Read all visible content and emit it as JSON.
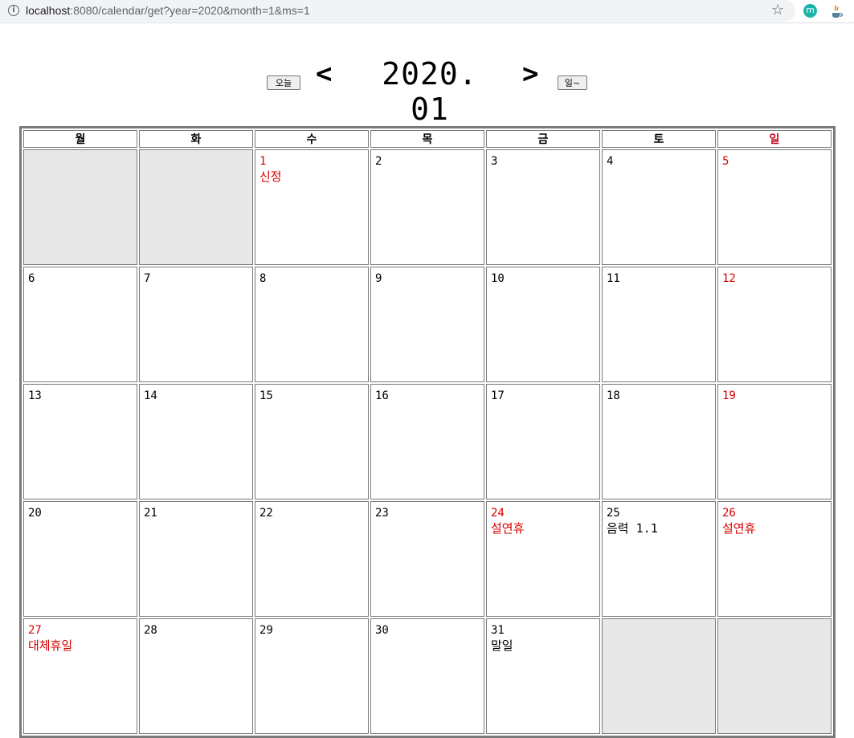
{
  "browser": {
    "url_host": "localhost",
    "url_rest": ":8080/calendar/get?year=2020&month=1&ms=1",
    "info_icon": "info-icon",
    "star_icon": "star-icon",
    "extensions": [
      {
        "name": "m-extension-icon",
        "label": "m"
      },
      {
        "name": "java-extension-icon",
        "label": ""
      }
    ]
  },
  "header": {
    "today_button": "오늘",
    "prev_arrow": "<",
    "title": "2020. 01",
    "next_arrow": ">",
    "week_start_button": "일~"
  },
  "weekdays": [
    "월",
    "화",
    "수",
    "목",
    "금",
    "토",
    "일"
  ],
  "weeks": [
    [
      {
        "empty": true
      },
      {
        "empty": true
      },
      {
        "day": "1",
        "note": "신정",
        "red": true
      },
      {
        "day": "2"
      },
      {
        "day": "3"
      },
      {
        "day": "4"
      },
      {
        "day": "5",
        "red": true
      }
    ],
    [
      {
        "day": "6"
      },
      {
        "day": "7"
      },
      {
        "day": "8"
      },
      {
        "day": "9"
      },
      {
        "day": "10"
      },
      {
        "day": "11"
      },
      {
        "day": "12",
        "red": true
      }
    ],
    [
      {
        "day": "13"
      },
      {
        "day": "14"
      },
      {
        "day": "15"
      },
      {
        "day": "16"
      },
      {
        "day": "17"
      },
      {
        "day": "18"
      },
      {
        "day": "19",
        "red": true
      }
    ],
    [
      {
        "day": "20"
      },
      {
        "day": "21"
      },
      {
        "day": "22"
      },
      {
        "day": "23"
      },
      {
        "day": "24",
        "note": "설연휴",
        "red": true
      },
      {
        "day": "25",
        "note": "음력 1.1"
      },
      {
        "day": "26",
        "note": "설연휴",
        "red": true
      }
    ],
    [
      {
        "day": "27",
        "note": "대체휴일",
        "red": true
      },
      {
        "day": "28"
      },
      {
        "day": "29"
      },
      {
        "day": "30"
      },
      {
        "day": "31",
        "note": "말일"
      },
      {
        "empty": true
      },
      {
        "empty": true
      }
    ]
  ],
  "colors": {
    "holiday": "#d90000",
    "empty_cell": "#e8e8e8",
    "border": "#7a7a7a"
  }
}
